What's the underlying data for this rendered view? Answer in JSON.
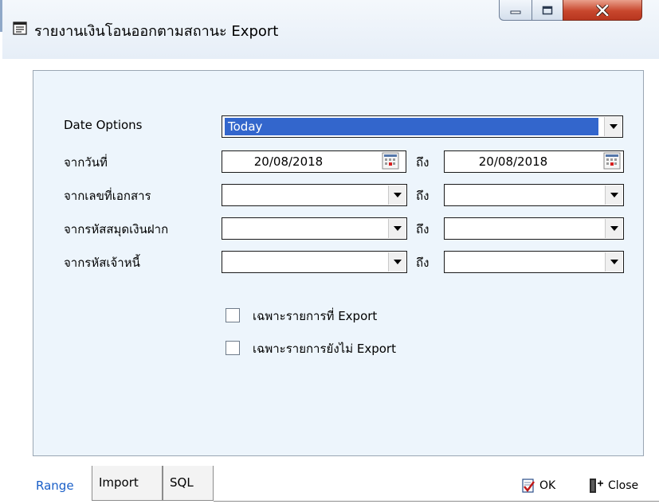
{
  "window": {
    "title": "รายงานเงินโอนออกตามสถานะ Export",
    "controls": {
      "minimize": "minimize",
      "maximize": "maximize",
      "close": "close"
    }
  },
  "form": {
    "date_options": {
      "label": "Date Options",
      "value": "Today"
    },
    "rows": [
      {
        "label": "จากวันที่",
        "from": "20/08/2018",
        "to_label": "ถึง",
        "to": "20/08/2018"
      },
      {
        "label": "จากเลขที่เอกสาร",
        "from": "",
        "to_label": "ถึง",
        "to": ""
      },
      {
        "label": "จากรหัสสมุดเงินฝาก",
        "from": "",
        "to_label": "ถึง",
        "to": ""
      },
      {
        "label": "จากรหัสเจ้าหนี้",
        "from": "",
        "to_label": "ถึง",
        "to": ""
      }
    ],
    "checkboxes": [
      {
        "label": "เฉพาะรายการที่ Export",
        "checked": false
      },
      {
        "label": "เฉพาะรายการยังไม่ Export",
        "checked": false
      }
    ]
  },
  "tabs": [
    {
      "label": "Range",
      "active": true
    },
    {
      "label": "Import",
      "active": false
    },
    {
      "label": "SQL",
      "active": false
    }
  ],
  "actions": {
    "ok": "OK",
    "close": "Close"
  },
  "colors": {
    "panel_bg": "#edf5fc",
    "selection": "#3366cc",
    "active_tab_text": "#1a5fc8",
    "close_button": "#c8472d"
  }
}
